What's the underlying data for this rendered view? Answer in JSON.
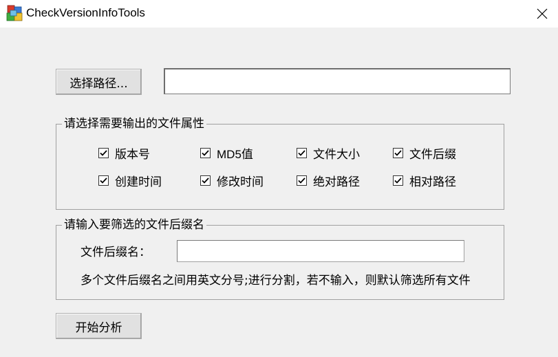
{
  "window": {
    "title": "CheckVersionInfoTools"
  },
  "path": {
    "button_label": "选择路径...",
    "value": ""
  },
  "attributes_group": {
    "legend": "请选择需要输出的文件属性",
    "items": [
      {
        "label": "版本号",
        "checked": true
      },
      {
        "label": "MD5值",
        "checked": true
      },
      {
        "label": "文件大小",
        "checked": true
      },
      {
        "label": "文件后缀",
        "checked": true
      },
      {
        "label": "创建时间",
        "checked": true
      },
      {
        "label": "修改时间",
        "checked": true
      },
      {
        "label": "绝对路径",
        "checked": true
      },
      {
        "label": "相对路径",
        "checked": true
      }
    ]
  },
  "filter_group": {
    "legend": "请输入要筛选的文件后缀名",
    "field_label": "文件后缀名：",
    "value": "",
    "hint": "多个文件后缀名之间用英文分号;进行分割，若不输入，则默认筛选所有文件"
  },
  "actions": {
    "start_label": "开始分析"
  },
  "icons": {
    "app": "cubes-app-icon",
    "close": "close-icon",
    "check": "checkmark-icon"
  }
}
